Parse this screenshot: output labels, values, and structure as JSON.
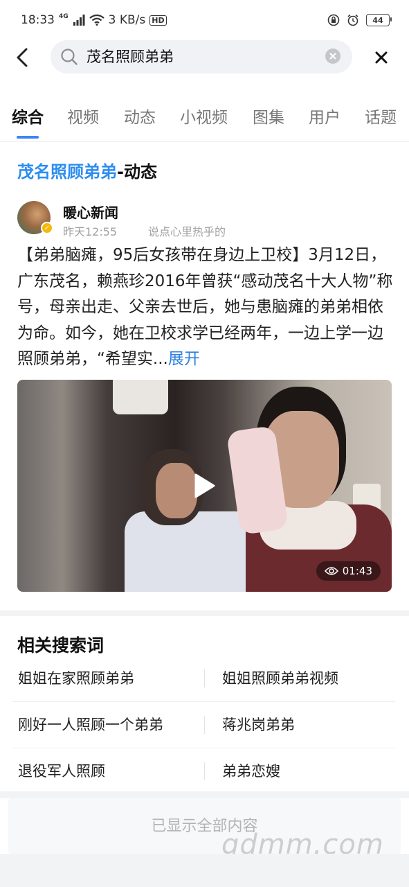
{
  "status_bar": {
    "time": "18:33",
    "network": "4G",
    "speed": "3 KB/s",
    "hd": "HD",
    "battery": "44"
  },
  "search": {
    "query": "茂名照顾弟弟"
  },
  "tabs": [
    {
      "label": "综合",
      "active": true
    },
    {
      "label": "视频"
    },
    {
      "label": "动态"
    },
    {
      "label": "小视频"
    },
    {
      "label": "图集"
    },
    {
      "label": "用户"
    },
    {
      "label": "话题"
    }
  ],
  "section": {
    "highlight": "茂名照顾弟弟",
    "suffix": "-动态"
  },
  "post": {
    "author": "暖心新闻",
    "time": "昨天12:55",
    "source": "说点心里热乎的",
    "body": "【弟弟脑瘫，95后女孩带在身边上卫校】3月12日，广东茂名，赖燕珍2016年曾获“感动茂名十大人物”称号，母亲出走、父亲去世后，她与患脑瘫的弟弟相依为命。如今，她在卫校求学已经两年，一边上学一边照顾弟弟，“希望实...",
    "expand": "展开",
    "video_duration": "01:43"
  },
  "related": {
    "title": "相关搜索词",
    "rows": [
      [
        "姐姐在家照顾弟弟",
        "姐姐照顾弟弟视频"
      ],
      [
        "刚好一人照顾一个弟弟",
        "蒋兆岗弟弟"
      ],
      [
        "退役军人照顾",
        "弟弟恋嫂"
      ]
    ]
  },
  "footer": {
    "end_text": "已显示全部内容",
    "watermark": "gdmm.com"
  },
  "colors": {
    "accent": "#2c8df0",
    "tab_indicator": "#3a86f5",
    "verified": "#f5b90a"
  },
  "icons": [
    "back-arrow-icon",
    "search-icon",
    "clear-icon",
    "close-icon",
    "play-icon",
    "eye-icon",
    "verified-icon"
  ]
}
